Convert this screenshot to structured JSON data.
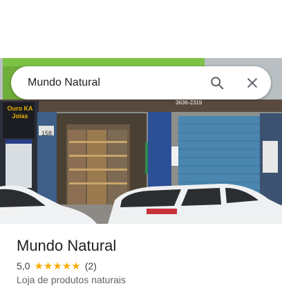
{
  "search": {
    "query": "Mundo Natural"
  },
  "photo": {
    "storefront_sign_text": "Ouro KA Joias",
    "shop_number": "158",
    "phone_text": "3636-2319"
  },
  "place": {
    "name": "Mundo Natural",
    "rating": "5,0",
    "stars": 5,
    "review_count": "(2)",
    "category": "Loja de produtos naturais"
  },
  "colors": {
    "star": "#f9ab00",
    "title": "#202124",
    "secondary": "#5f6368"
  },
  "icons": {
    "search": "search-icon",
    "close": "close-icon",
    "star": "star-icon"
  }
}
